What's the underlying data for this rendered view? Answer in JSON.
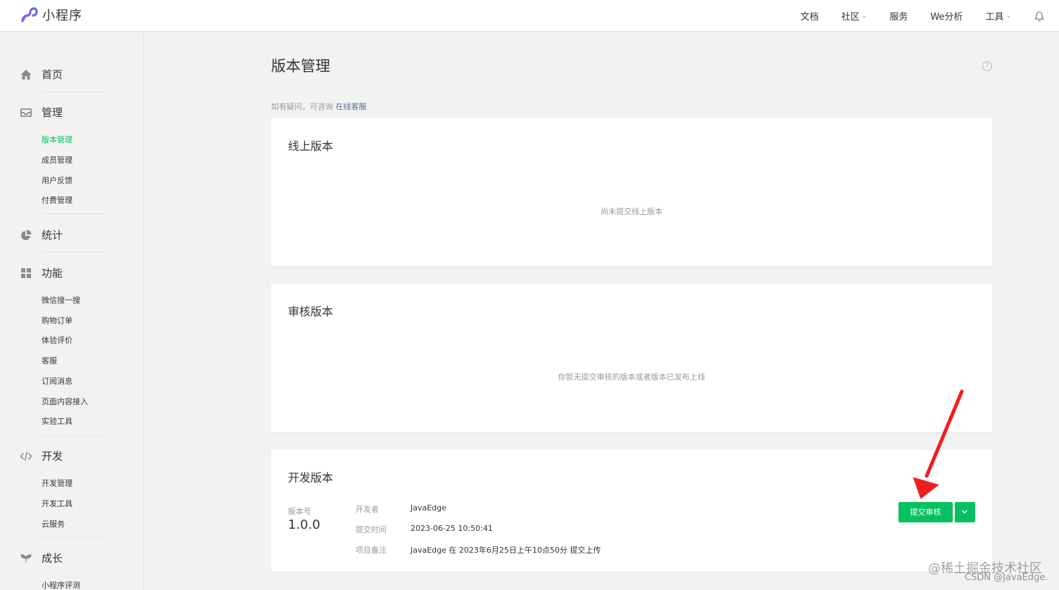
{
  "app": {
    "name": "小程序"
  },
  "topnav": {
    "items": [
      {
        "label": "文档",
        "has_dropdown": false
      },
      {
        "label": "社区",
        "has_dropdown": true
      },
      {
        "label": "服务",
        "has_dropdown": false
      },
      {
        "label": "We分析",
        "has_dropdown": false
      },
      {
        "label": "工具",
        "has_dropdown": true
      }
    ],
    "bell_icon": "bell-icon"
  },
  "sidebar": {
    "groups": [
      {
        "icon": "home-icon",
        "label": "首页",
        "items": []
      },
      {
        "icon": "inbox-icon",
        "label": "管理",
        "items": [
          "版本管理",
          "成员管理",
          "用户反馈",
          "付费管理"
        ],
        "active": "版本管理"
      },
      {
        "icon": "pie-chart-icon",
        "label": "统计",
        "items": []
      },
      {
        "icon": "grid-icon",
        "label": "功能",
        "items": [
          "微信搜一搜",
          "购物订单",
          "体验评价",
          "客服",
          "订阅消息",
          "页面内容接入",
          "实验工具"
        ]
      },
      {
        "icon": "code-icon",
        "label": "开发",
        "items": [
          "开发管理",
          "开发工具",
          "云服务"
        ]
      },
      {
        "icon": "sprout-icon",
        "label": "成长",
        "items": [
          "小程序评测"
        ]
      }
    ]
  },
  "main": {
    "title": "版本管理",
    "help_icon": "question-icon",
    "hint_prefix": "如有疑问，可咨询",
    "hint_link": "在线客服",
    "online": {
      "title": "线上版本",
      "empty": "尚未提交线上版本"
    },
    "review": {
      "title": "审核版本",
      "empty": "你暂无提交审核的版本或者版本已发布上线"
    },
    "dev": {
      "title": "开发版本",
      "version_label": "版本号",
      "version": "1.0.0",
      "developer_key": "开发者",
      "developer": "JavaEdge",
      "time_key": "提交时间",
      "time": "2023-06-25 10:50:41",
      "note_key": "项目备注",
      "note": "JavaEdge 在 2023年6月25日上午10点50分 提交上传",
      "submit_button": "提交审核"
    }
  },
  "colors": {
    "accent": "#07c160",
    "link": "#576b95",
    "annotation_arrow": "#f01e1e"
  },
  "watermark": {
    "line1": "@稀土掘金技术社区",
    "line2": "CSDN @JavaEdge."
  }
}
